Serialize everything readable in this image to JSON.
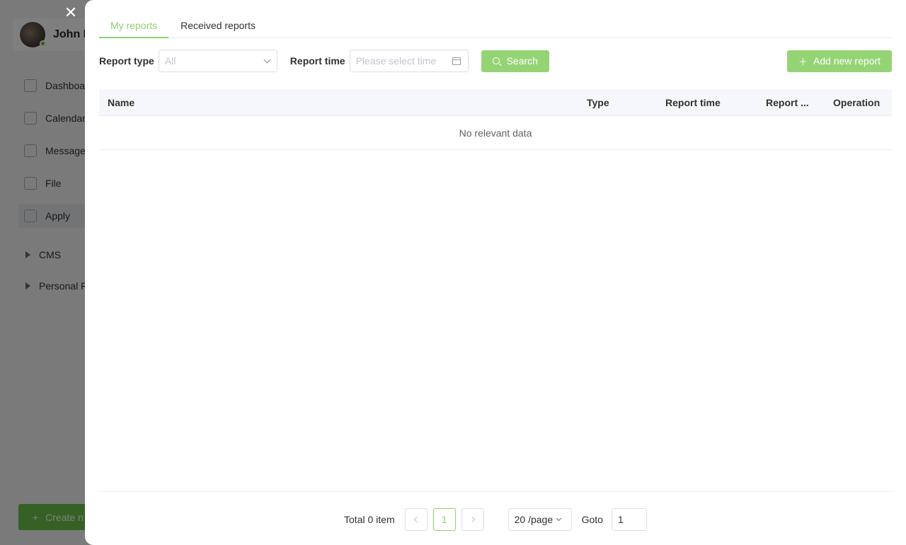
{
  "background": {
    "user_name": "John I",
    "nav": [
      "Dashboa",
      "Calendar",
      "Message",
      "File",
      "Apply"
    ],
    "groups": [
      "CMS",
      "Personal F"
    ],
    "create_label": "Create n"
  },
  "close_label": "✕",
  "tabs": [
    {
      "label": "My reports",
      "active": true
    },
    {
      "label": "Received reports",
      "active": false
    }
  ],
  "filters": {
    "report_type_label": "Report type",
    "report_type_value": "All",
    "report_time_label": "Report time",
    "report_time_placeholder": "Please select time",
    "search_label": "Search",
    "add_label": "Add new report"
  },
  "table": {
    "columns": [
      "Name",
      "Type",
      "Report time",
      "Report ...",
      "Operation"
    ],
    "empty_text": "No relevant data"
  },
  "pagination": {
    "total_text": "Total 0 item",
    "current_page": "1",
    "page_size": "20 /page",
    "goto_label": "Goto",
    "goto_value": "1"
  },
  "colors": {
    "accent": "#8fcf6f",
    "button": "#95d475"
  }
}
